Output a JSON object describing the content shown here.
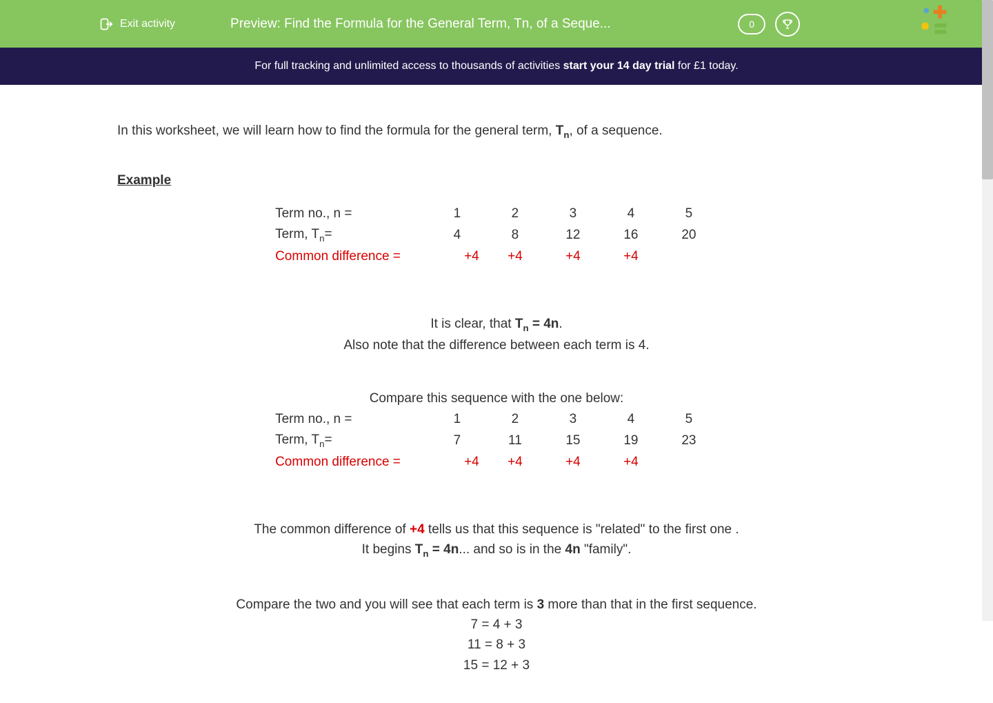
{
  "header": {
    "exit_label": "Exit activity",
    "title": "Preview: Find the Formula for the General Term, Tn, of a Seque...",
    "score": "0"
  },
  "promo": {
    "prefix": "For full tracking and unlimited access to thousands of activities ",
    "bold": "start your 14 day trial",
    "suffix": " for £1 today."
  },
  "content": {
    "intro_prefix": "In this worksheet, we will learn how to find the formula for the general term, ",
    "intro_tn": "T",
    "intro_sub": "n",
    "intro_suffix": ", of a sequence.",
    "example_label": "Example",
    "tbl1": {
      "r1_label": "Term no., n =",
      "r1": [
        "1",
        "2",
        "3",
        "4",
        "5"
      ],
      "r2_label_pre": "Term, T",
      "r2_label_sub": "n",
      "r2_label_post": "=",
      "r2": [
        "4",
        "8",
        "12",
        "16",
        "20"
      ],
      "r3_label": "Common difference =",
      "r3": [
        "+4",
        "+4",
        "+4",
        "+4"
      ]
    },
    "p1_pre": "It is clear, that ",
    "p1_bold_pre": "T",
    "p1_bold_sub": "n",
    "p1_bold_post": " = 4n",
    "p1_suffix": ".",
    "p2": "Also note that the difference between each term is 4.",
    "p3": "Compare this sequence with the one below:",
    "tbl2": {
      "r1_label": "Term no., n =",
      "r1": [
        "1",
        "2",
        "3",
        "4",
        "5"
      ],
      "r2_label_pre": "Term, T",
      "r2_label_sub": "n",
      "r2_label_post": "=",
      "r2": [
        "7",
        "11",
        "15",
        "19",
        "23"
      ],
      "r3_label": "Common difference =",
      "r3": [
        "+4",
        "+4",
        "+4",
        "+4"
      ]
    },
    "p4_pre": "The common difference of ",
    "p4_red": "+4",
    "p4_post": " tells us that this sequence is \"related\" to the first one .",
    "p5_pre": "It begins ",
    "p5_bold_pre": "T",
    "p5_bold_sub": "n",
    "p5_bold_post": " = 4n",
    "p5_mid": "... and so is in the ",
    "p5_bold2": "4n",
    "p5_suffix": " \"family\".",
    "p6_pre": "Compare the two and you will see that each term is ",
    "p6_bold": "3",
    "p6_post": " more than that in the first sequence.",
    "eqs": [
      "7 = 4 + 3",
      "11 = 8 + 3",
      "15 = 12 + 3"
    ]
  }
}
